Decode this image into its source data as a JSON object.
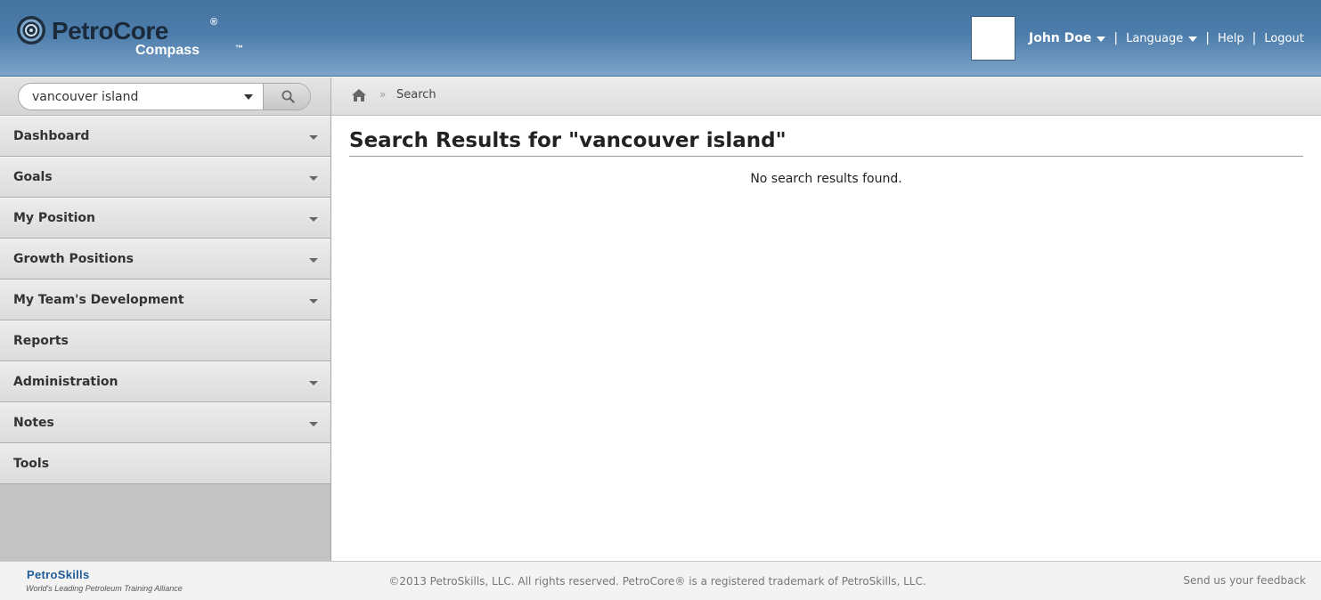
{
  "header": {
    "logo_title": "PetroCore",
    "logo_registered": "®",
    "logo_subtitle": "Compass",
    "logo_trademark": "™",
    "user_name": "John Doe",
    "language_label": "Language",
    "help_label": "Help",
    "logout_label": "Logout",
    "separator": "|"
  },
  "search": {
    "value": "vancouver island",
    "button_icon": "search-icon"
  },
  "breadcrumb": {
    "home_icon": "home-icon",
    "separator": "»",
    "current": "Search"
  },
  "sidebar": {
    "items": [
      {
        "label": "Dashboard",
        "has_dropdown": true
      },
      {
        "label": "Goals",
        "has_dropdown": true
      },
      {
        "label": "My Position",
        "has_dropdown": true
      },
      {
        "label": "Growth Positions",
        "has_dropdown": true
      },
      {
        "label": "My Team's Development",
        "has_dropdown": true
      },
      {
        "label": "Reports",
        "has_dropdown": false
      },
      {
        "label": "Administration",
        "has_dropdown": true
      },
      {
        "label": "Notes",
        "has_dropdown": true
      },
      {
        "label": "Tools",
        "has_dropdown": false
      }
    ]
  },
  "main": {
    "title": "Search Results for \"vancouver island\"",
    "no_results": "No search results found."
  },
  "footer": {
    "brand": "PetroSkills",
    "tagline": "World's Leading Petroleum Training Alliance",
    "copyright": "©2013 PetroSkills, LLC. All rights reserved. PetroCore® is a registered trademark of PetroSkills, LLC.",
    "feedback": "Send us your feedback"
  },
  "colors": {
    "header_top": "#4573a0",
    "header_bottom": "#7ea4c9",
    "footer_brand": "#1f5c98"
  }
}
